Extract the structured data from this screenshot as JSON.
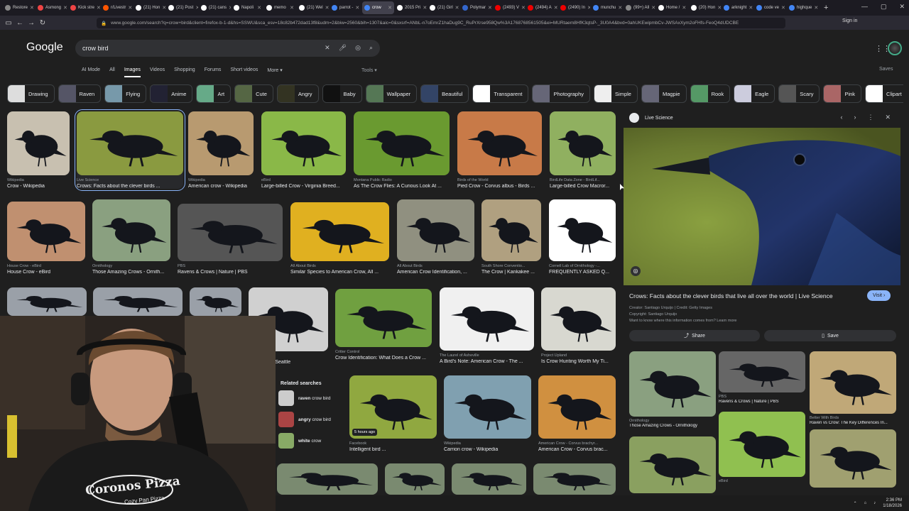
{
  "browser": {
    "tabs": [
      {
        "label": "Restore",
        "color": "#888"
      },
      {
        "label": "Asmong",
        "color": "#e44"
      },
      {
        "label": "Kick stre",
        "color": "#e44"
      },
      {
        "label": "r/Livestr",
        "color": "#f50"
      },
      {
        "label": "(21) Hon",
        "color": "#fff"
      },
      {
        "label": "(21) Post",
        "color": "#fff"
      },
      {
        "label": "(21) cans",
        "color": "#fff"
      },
      {
        "label": "Napoli",
        "color": "#fff"
      },
      {
        "label": "memo",
        "color": "#fff"
      },
      {
        "label": "(21) Wel",
        "color": "#fff"
      },
      {
        "label": "parrot -",
        "color": "#4285f4"
      },
      {
        "label": "crow",
        "color": "#4285f4"
      },
      {
        "label": "2015 Pri",
        "color": "#fff"
      },
      {
        "label": "(21) Girl",
        "color": "#fff"
      },
      {
        "label": "Polymar",
        "color": "#36c"
      },
      {
        "label": "(2493) V",
        "color": "#e00"
      },
      {
        "label": "(2494) A",
        "color": "#e00"
      },
      {
        "label": "(2490) In",
        "color": "#e00"
      },
      {
        "label": "munchu",
        "color": "#4285f4"
      },
      {
        "label": "(99+) All",
        "color": "#888"
      },
      {
        "label": "Home /",
        "color": "#fff"
      },
      {
        "label": "(20) Hon",
        "color": "#fff"
      },
      {
        "label": "arknight",
        "color": "#4285f4"
      },
      {
        "label": "code ve",
        "color": "#4285f4"
      },
      {
        "label": "highque",
        "color": "#4285f4"
      }
    ],
    "active_tab": 11,
    "url": "www.google.com/search?q=crow+bird&client=firefox-b-1-d&hs=SSWU&sca_esv=18c82b472dad13f8&udm=2&biw=2560&bih=1307&aic=0&sxsrf=ANbL-n7oEmrZ1haDug9C_RuPrXrse958Qw%3A1768768561505&ei=MURtaem8HfK3qtsP-_3U0A4&bvd=0ahUKEwipmbCv-JWSAxXym2oFHfs-FeoQ4dUDCBE",
    "signin": "Sign in"
  },
  "google": {
    "logo": "Google",
    "query": "crow bird",
    "nav": [
      "AI Mode",
      "All",
      "Images",
      "Videos",
      "Shopping",
      "Forums",
      "Short videos",
      "More ▾"
    ],
    "active_nav": "Images",
    "tools": "Tools ▾",
    "saves": "Saves"
  },
  "chips": [
    {
      "label": "Drawing",
      "color": "#ddd"
    },
    {
      "label": "Raven",
      "color": "#556"
    },
    {
      "label": "Flying",
      "color": "#79a"
    },
    {
      "label": "Anime",
      "color": "#223"
    },
    {
      "label": "Art",
      "color": "#6a8"
    },
    {
      "label": "Cute",
      "color": "#564"
    },
    {
      "label": "Angry",
      "color": "#332"
    },
    {
      "label": "Baby",
      "color": "#111"
    },
    {
      "label": "Wallpaper",
      "color": "#575"
    },
    {
      "label": "Beautiful",
      "color": "#346"
    },
    {
      "label": "Transparent",
      "color": "#fff"
    },
    {
      "label": "Photography",
      "color": "#667"
    },
    {
      "label": "Simple",
      "color": "#eee"
    },
    {
      "label": "Magpie",
      "color": "#667"
    },
    {
      "label": "Rook",
      "color": "#596"
    },
    {
      "label": "Eagle",
      "color": "#ccd"
    },
    {
      "label": "Scary",
      "color": "#555"
    },
    {
      "label": "Pink",
      "color": "#a66"
    },
    {
      "label": "Clipart black",
      "color": "#fff"
    }
  ],
  "results_row1": [
    {
      "src": "Wikipedia",
      "cap": "Crow - Wikipedia",
      "bg": "#c8c0b0"
    },
    {
      "src": "Live Science",
      "cap": "Crows: Facts about the clever birds ...",
      "bg": "#8a9a40"
    },
    {
      "src": "Wikipedia",
      "cap": "American crow - Wikipedia",
      "bg": "#b89a70"
    },
    {
      "src": "eBird",
      "cap": "Large-billed Crow - Virginia Breed...",
      "bg": "#8ab848"
    },
    {
      "src": "Montana Public Radio",
      "cap": "As The Crow Flies: A Curious Look At ...",
      "bg": "#6a9a30"
    },
    {
      "src": "Birds of the World",
      "cap": "Pied Crow - Corvus albus - Birds ...",
      "bg": "#c87a48"
    },
    {
      "src": "BirdLife Data Zone - BirdLif...",
      "cap": "Large-billed Crow Macror...",
      "bg": "#90b060"
    }
  ],
  "results_row2": [
    {
      "src": "House Crow - eBird",
      "cap": "House Crow - eBird",
      "bg": "#c09070"
    },
    {
      "src": "Ornithology",
      "cap": "Those Amazing Crows - Ornith...",
      "bg": "#8aa080"
    },
    {
      "src": "PBS",
      "cap": "Ravens & Crows | Nature | PBS",
      "bg": "#555"
    },
    {
      "src": "All About Birds",
      "cap": "Similar Species to American Crow, All ...",
      "bg": "#e0b020"
    },
    {
      "src": "All About Birds",
      "cap": "American Crow Identification, ...",
      "bg": "#909080"
    },
    {
      "src": "South Shore Conventio...",
      "cap": "The Crow | Kankakee ...",
      "bg": "#b0a080"
    },
    {
      "src": "Cornell Lab of Ornithology -...",
      "cap": "FREQUENTLY ASKED Q...",
      "bg": "#ffffff"
    }
  ],
  "results_row3": [
    {
      "src": "ect Seattle",
      "cap": "ds Connect Seattle",
      "bg": "#d0d0d0"
    },
    {
      "src": "Critter Control",
      "cap": "Crow Identification: What Does a Crow ...",
      "bg": "#70a040"
    },
    {
      "src": "The Laurel of Asheville",
      "cap": "A Bird's Note: American Crow - The ...",
      "bg": "#f0f0f0"
    },
    {
      "src": "Project Upland",
      "cap": "Is Crow Hunting Worth My Ti...",
      "bg": "#d8d8d0"
    }
  ],
  "results_row4": [
    {
      "src": "Facebook",
      "cap": "Intelligent bird ...",
      "bg": "#90a840",
      "badge": "5 hours ago"
    },
    {
      "src": "Wikipedia",
      "cap": "Carrion crow - Wikipedia",
      "bg": "#80a0b0"
    },
    {
      "src": "American Crow - Corvus brachyr...",
      "cap": "American Crow - Corvus brac...",
      "bg": "#d09040"
    }
  ],
  "related": {
    "title": "Related searches",
    "items": [
      {
        "bold": "raven",
        "rest": "crow bird",
        "color": "#ccc"
      },
      {
        "bold": "angry",
        "rest": "crow bird",
        "color": "#a44"
      },
      {
        "bold": "white",
        "rest": "crow",
        "color": "#8a6"
      }
    ]
  },
  "panel": {
    "site": "Live Science",
    "title": "Crows: Facts about the clever birds that live all over the world | Live Science",
    "visit": "Visit ›",
    "creator": "Creator: Santiago Urquijo | Credit: Getty Images",
    "copyright": "Copyright: Santiago Urquijo",
    "learn": "Want to know where this information comes from? Learn more",
    "share": "Share",
    "save": "Save",
    "related": [
      {
        "src": "Ornithology",
        "cap": "Those Amazing Crows - Ornithology",
        "bg": "#8aa080"
      },
      {
        "src": "PBS",
        "cap": "Ravens & Crows | Nature | PBS",
        "bg": "#666"
      },
      {
        "src": "Better With Birds",
        "cap": "Raven vs Crow: The Key Differences In...",
        "bg": "#c0a878"
      },
      {
        "src": "",
        "cap": "",
        "bg": "#8aa060"
      },
      {
        "src": "eBird",
        "cap": "",
        "bg": "#90c050"
      },
      {
        "src": "",
        "cap": "",
        "bg": "#a0a070"
      }
    ]
  },
  "webcam": {
    "shirt": "Coronos Pizza",
    "shirt2": "Cozy Pan Pizza"
  },
  "taskbar": {
    "time": "2:36 PM",
    "date": "1/18/2026"
  }
}
